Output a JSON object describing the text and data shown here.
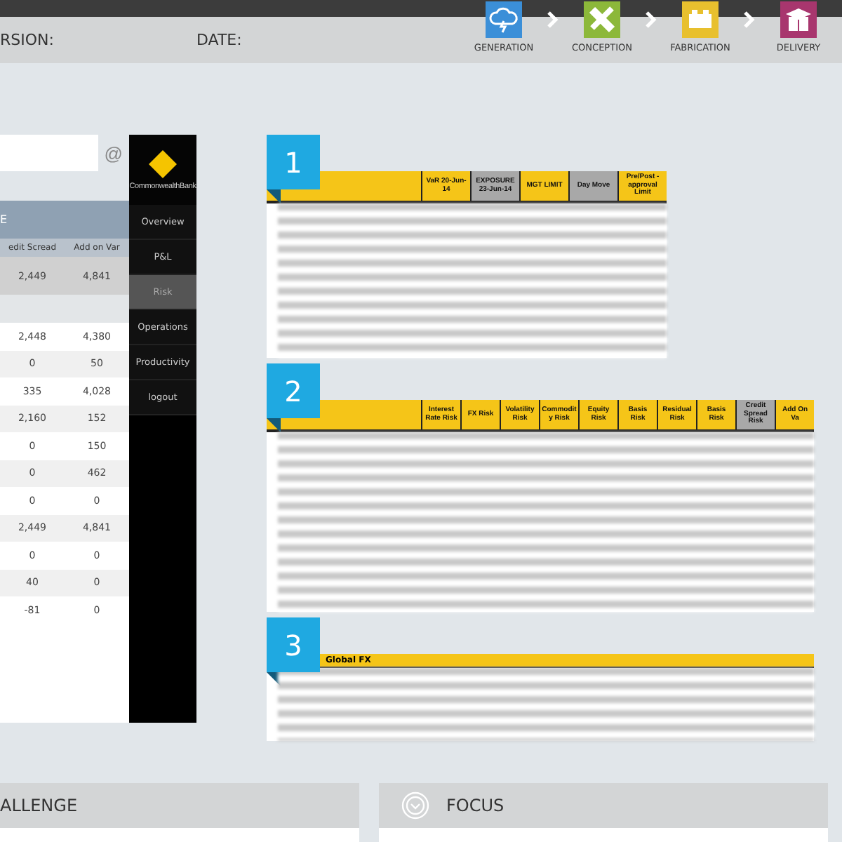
{
  "header": {
    "version_label": "RSION:",
    "date_label": "DATE:"
  },
  "steps": [
    {
      "label": "GENERATION",
      "kind": "cloud",
      "color": "#3b8fd8"
    },
    {
      "label": "CONCEPTION",
      "kind": "tools",
      "color": "#8cb83a"
    },
    {
      "label": "FABRICATION",
      "kind": "blocks",
      "color": "#e8c02e"
    },
    {
      "label": "DELIVERY",
      "kind": "box",
      "color": "#a8366e"
    }
  ],
  "search": {
    "button": "@"
  },
  "table": {
    "title": "E",
    "columns": [
      "edit Scread",
      "Add on Var"
    ],
    "rows": [
      {
        "kind": "total",
        "cells": [
          "2,449",
          "4,841"
        ]
      },
      {
        "kind": "section"
      },
      {
        "kind": "data",
        "cells": [
          "2,448",
          "4,380"
        ]
      },
      {
        "kind": "data",
        "cells": [
          "0",
          "50"
        ]
      },
      {
        "kind": "data",
        "cells": [
          "335",
          "4,028"
        ]
      },
      {
        "kind": "data",
        "cells": [
          "2,160",
          "152"
        ]
      },
      {
        "kind": "data",
        "cells": [
          "0",
          "150"
        ]
      },
      {
        "kind": "data",
        "cells": [
          "0",
          "462"
        ]
      },
      {
        "kind": "data",
        "cells": [
          "0",
          "0"
        ]
      },
      {
        "kind": "data",
        "cells": [
          "2,449",
          "4,841"
        ]
      },
      {
        "kind": "data",
        "cells": [
          "0",
          "0"
        ]
      },
      {
        "kind": "data",
        "cells": [
          "40",
          "0"
        ]
      },
      {
        "kind": "data",
        "cells": [
          "-81",
          "0"
        ]
      }
    ]
  },
  "brand": {
    "name": "CommonwealthBank"
  },
  "nav": [
    {
      "label": "Overview",
      "selected": false
    },
    {
      "label": "P&L",
      "selected": false
    },
    {
      "label": "Risk",
      "selected": true
    },
    {
      "label": "Operations",
      "selected": false
    },
    {
      "label": "Productivity",
      "selected": false
    },
    {
      "label": "logout",
      "selected": false
    }
  ],
  "reports": [
    {
      "number": "1",
      "columns": [
        {
          "label": "VaR 20-Jun-14",
          "shaded": false
        },
        {
          "label": "EXPOSURE 23-Jun-14",
          "shaded": true
        },
        {
          "label": "MGT LIMIT",
          "shaded": false
        },
        {
          "label": "Day Move",
          "shaded": true
        },
        {
          "label": "Pre/Post - approval Limit",
          "shaded": false
        }
      ]
    },
    {
      "number": "2",
      "columns": [
        {
          "label": "Interest Rate Risk",
          "shaded": false
        },
        {
          "label": "FX Risk",
          "shaded": false
        },
        {
          "label": "Volatility Risk",
          "shaded": false
        },
        {
          "label": "Commodity Risk",
          "shaded": false
        },
        {
          "label": "Equity Risk",
          "shaded": false
        },
        {
          "label": "Basis Risk",
          "shaded": false
        },
        {
          "label": "Residual Risk",
          "shaded": false
        },
        {
          "label": "Basis Risk",
          "shaded": false
        },
        {
          "label": "Credit Spread Risk",
          "shaded": true
        },
        {
          "label": "Add On Va",
          "shaded": false
        }
      ]
    },
    {
      "number": "3",
      "section": "Global FX"
    }
  ],
  "cards": [
    {
      "title": "ALLENGE",
      "icon": false
    },
    {
      "title": "FOCUS",
      "icon": true
    }
  ]
}
